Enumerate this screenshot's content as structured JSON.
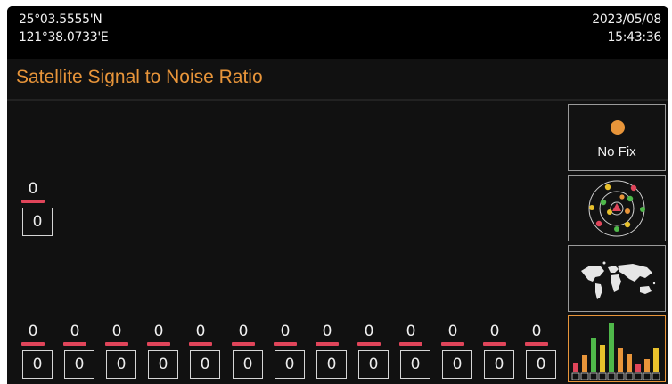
{
  "header": {
    "latitude": "25°03.5555'N",
    "longitude": "121°38.0733'E",
    "date": "2023/05/08",
    "time": "15:43:36"
  },
  "page_title": "Satellite Signal to Noise Ratio",
  "satellites_raised": [
    {
      "snr": "0",
      "prn": "0"
    }
  ],
  "satellites_row": [
    {
      "snr": "0",
      "prn": "0"
    },
    {
      "snr": "0",
      "prn": "0"
    },
    {
      "snr": "0",
      "prn": "0"
    },
    {
      "snr": "0",
      "prn": "0"
    },
    {
      "snr": "0",
      "prn": "0"
    },
    {
      "snr": "0",
      "prn": "0"
    },
    {
      "snr": "0",
      "prn": "0"
    },
    {
      "snr": "0",
      "prn": "0"
    },
    {
      "snr": "0",
      "prn": "0"
    },
    {
      "snr": "0",
      "prn": "0"
    },
    {
      "snr": "0",
      "prn": "0"
    },
    {
      "snr": "0",
      "prn": "0"
    },
    {
      "snr": "0",
      "prn": "0"
    }
  ],
  "side_menu": {
    "fix_status": "No Fix",
    "fix_status_color": "#e8953a",
    "sky_view_icon": "satellite-sky-view-icon",
    "world_map_icon": "world-map-icon",
    "snr_chart_icon": "snr-bar-chart-icon"
  },
  "colors": {
    "accent": "#e8953a",
    "snr_bar": "#e0455a",
    "background": "#111111"
  }
}
